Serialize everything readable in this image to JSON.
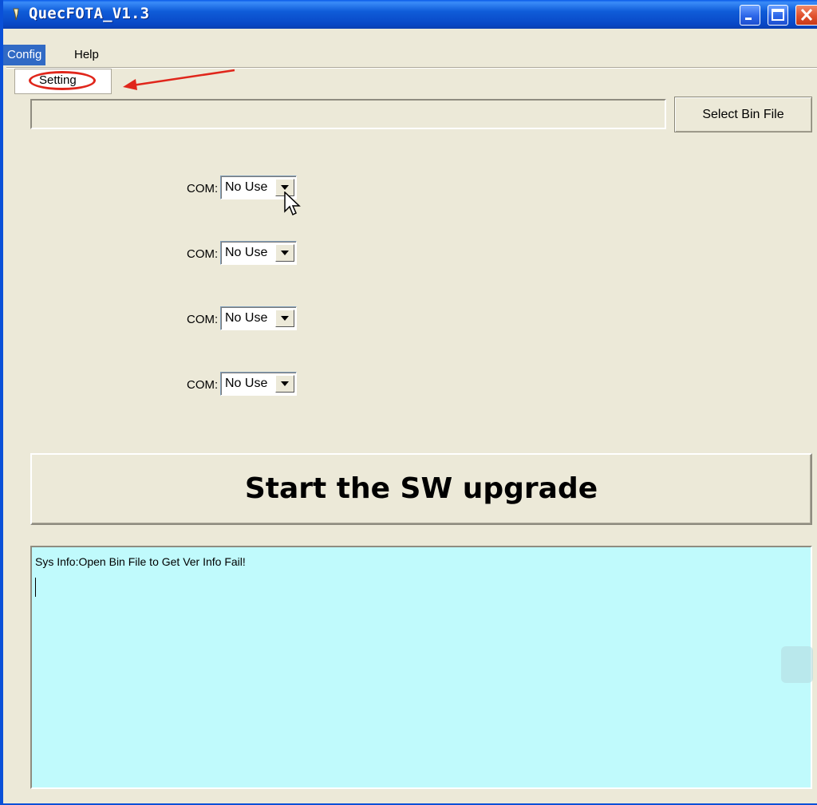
{
  "window": {
    "title": "QuecFOTA_V1.3",
    "controls": [
      "minimize-icon",
      "maximize-icon",
      "close-icon"
    ]
  },
  "menubar": {
    "items": [
      {
        "label": "Config",
        "active": true
      },
      {
        "label": "Help",
        "active": false
      }
    ],
    "config_dropdown": {
      "items": [
        {
          "label": "Setting"
        }
      ]
    }
  },
  "file_row": {
    "path_value": "",
    "select_button_label": "Select Bin File"
  },
  "com_ports": [
    {
      "label": "COM:",
      "value": "No Use"
    },
    {
      "label": "COM:",
      "value": "No Use"
    },
    {
      "label": "COM:",
      "value": "No Use"
    },
    {
      "label": "COM:",
      "value": "No Use"
    }
  ],
  "start_button_label": "Start the SW upgrade",
  "log": {
    "text": "Sys Info:Open Bin File to Get Ver Info Fail!"
  },
  "colors": {
    "titlebar": "#0a5ae8",
    "face": "#ece9d8",
    "log_background": "#c0fafc",
    "menu_highlight": "#316ac5",
    "annotation": "#e0261b"
  }
}
